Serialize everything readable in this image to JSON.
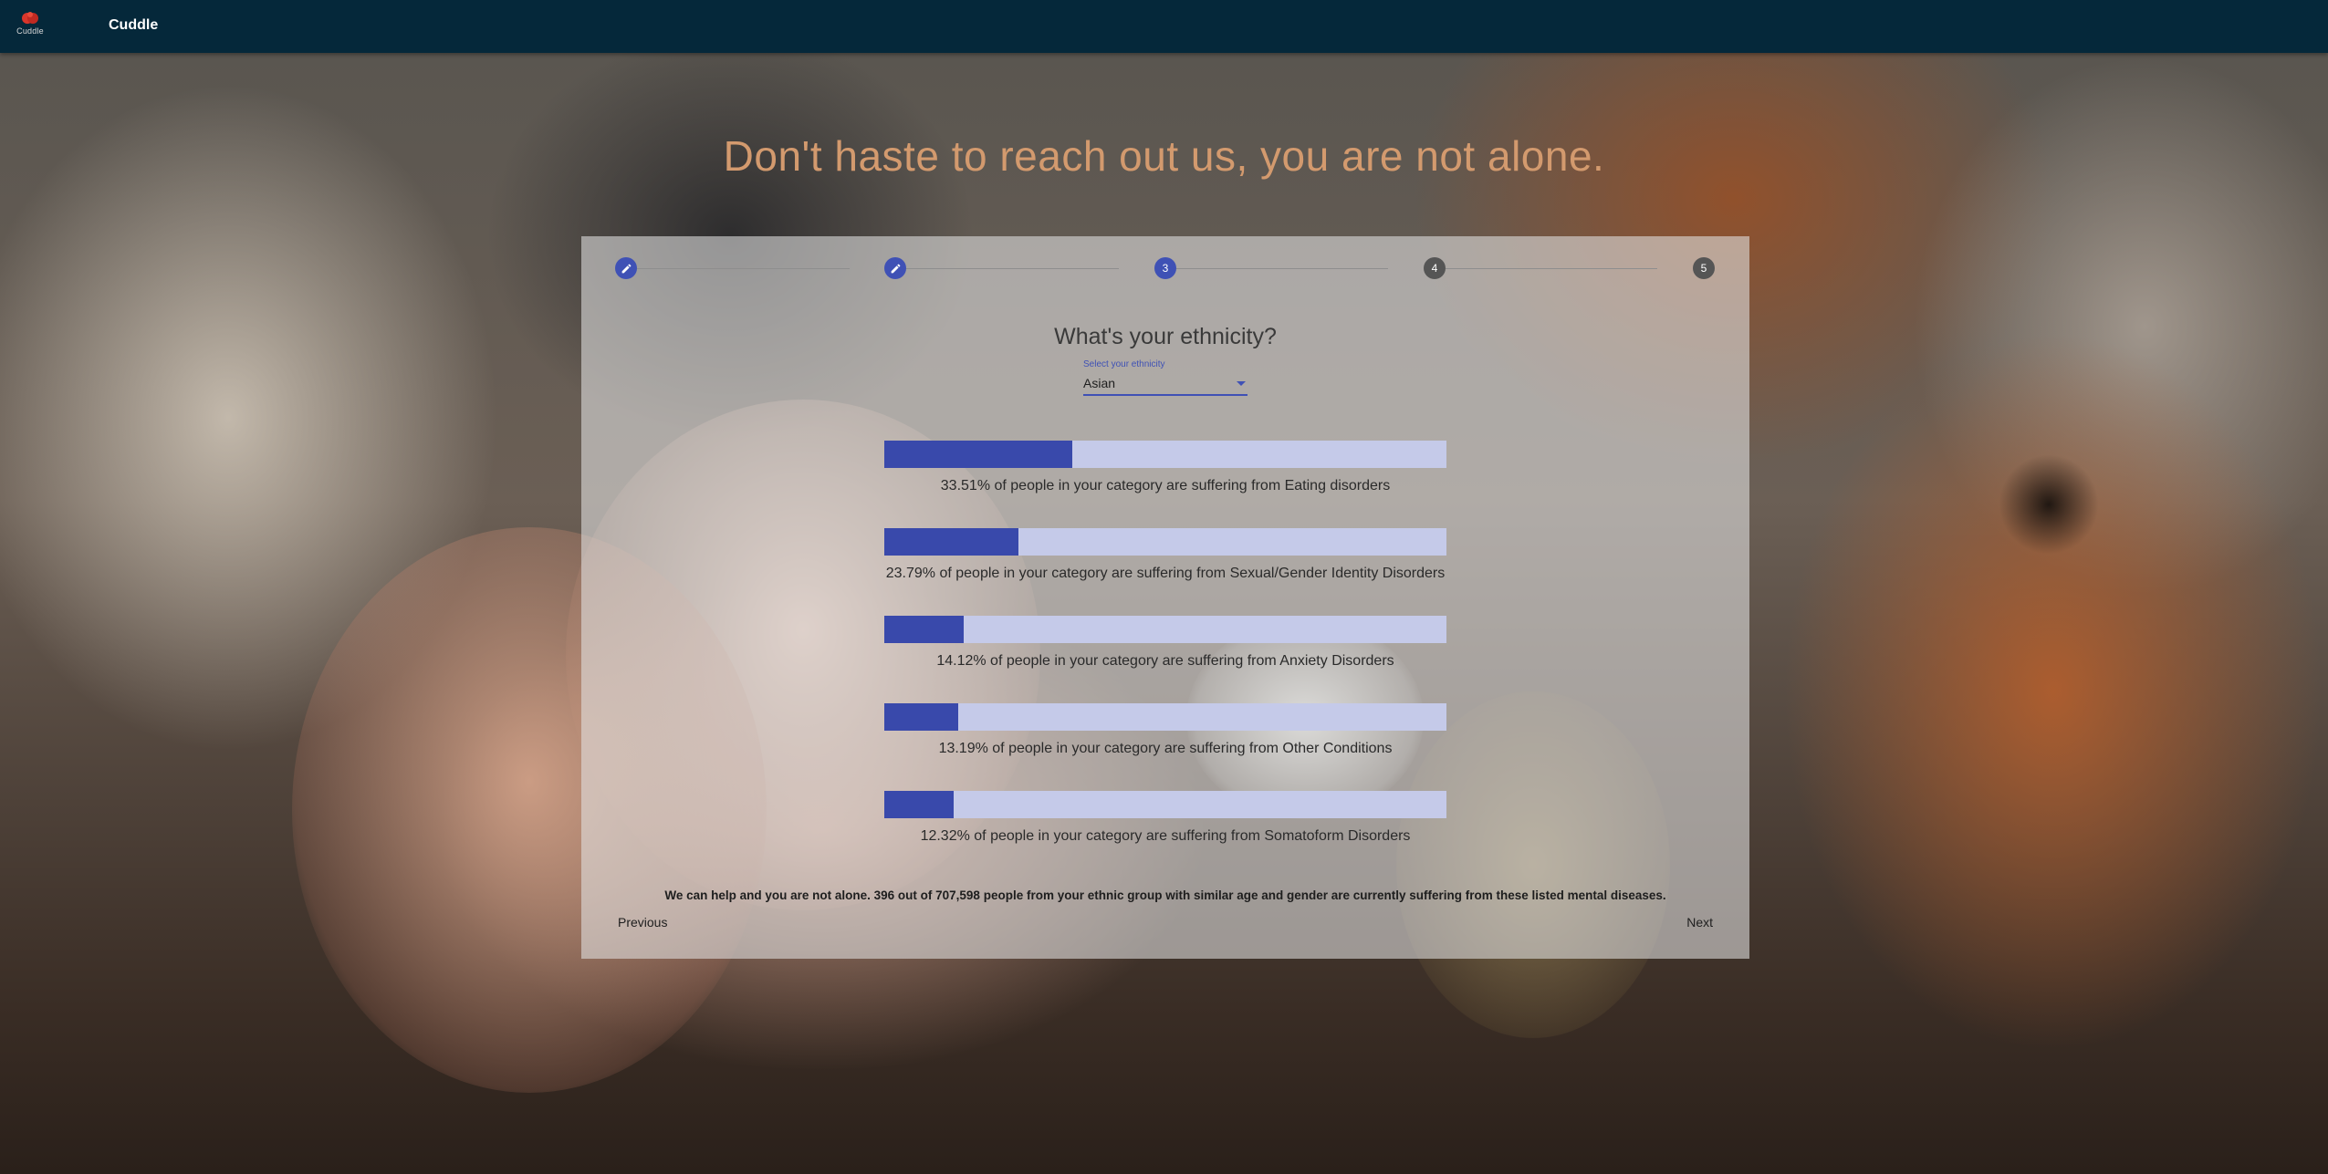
{
  "app": {
    "logo_text": "Cuddle",
    "title": "Cuddle"
  },
  "headline": "Don't haste to reach out us, you are not alone.",
  "stepper": {
    "steps": [
      {
        "label": "1",
        "state": "done",
        "icon": "edit-icon"
      },
      {
        "label": "2",
        "state": "done",
        "icon": "edit-icon"
      },
      {
        "label": "3",
        "state": "active"
      },
      {
        "label": "4",
        "state": "todo"
      },
      {
        "label": "5",
        "state": "todo"
      }
    ]
  },
  "question": "What's your ethnicity?",
  "ethnicity_select": {
    "label": "Select your ethnicity",
    "value": "Asian"
  },
  "stats": [
    {
      "percent": 33.51,
      "text": "33.51% of people in your category are suffering from Eating disorders"
    },
    {
      "percent": 23.79,
      "text": "23.79% of people in your category are suffering from Sexual/Gender Identity Disorders"
    },
    {
      "percent": 14.12,
      "text": "14.12% of people in your category are suffering from Anxiety Disorders"
    },
    {
      "percent": 13.19,
      "text": "13.19% of people in your category are suffering from Other Conditions"
    },
    {
      "percent": 12.32,
      "text": "12.32% of people in your category are suffering from Somatoform Disorders"
    }
  ],
  "summary": "We can help and you are not alone. 396 out of 707,598 people from your ethnic group with similar age and gender are currently suffering from these listed mental diseases.",
  "nav": {
    "previous_label": "Previous",
    "next_label": "Next"
  },
  "colors": {
    "appbar": "#05283a",
    "accent": "#3f51b5",
    "bar_fill": "#3949ab",
    "bar_track": "#c5cae9",
    "headline": "#d39a6e"
  }
}
